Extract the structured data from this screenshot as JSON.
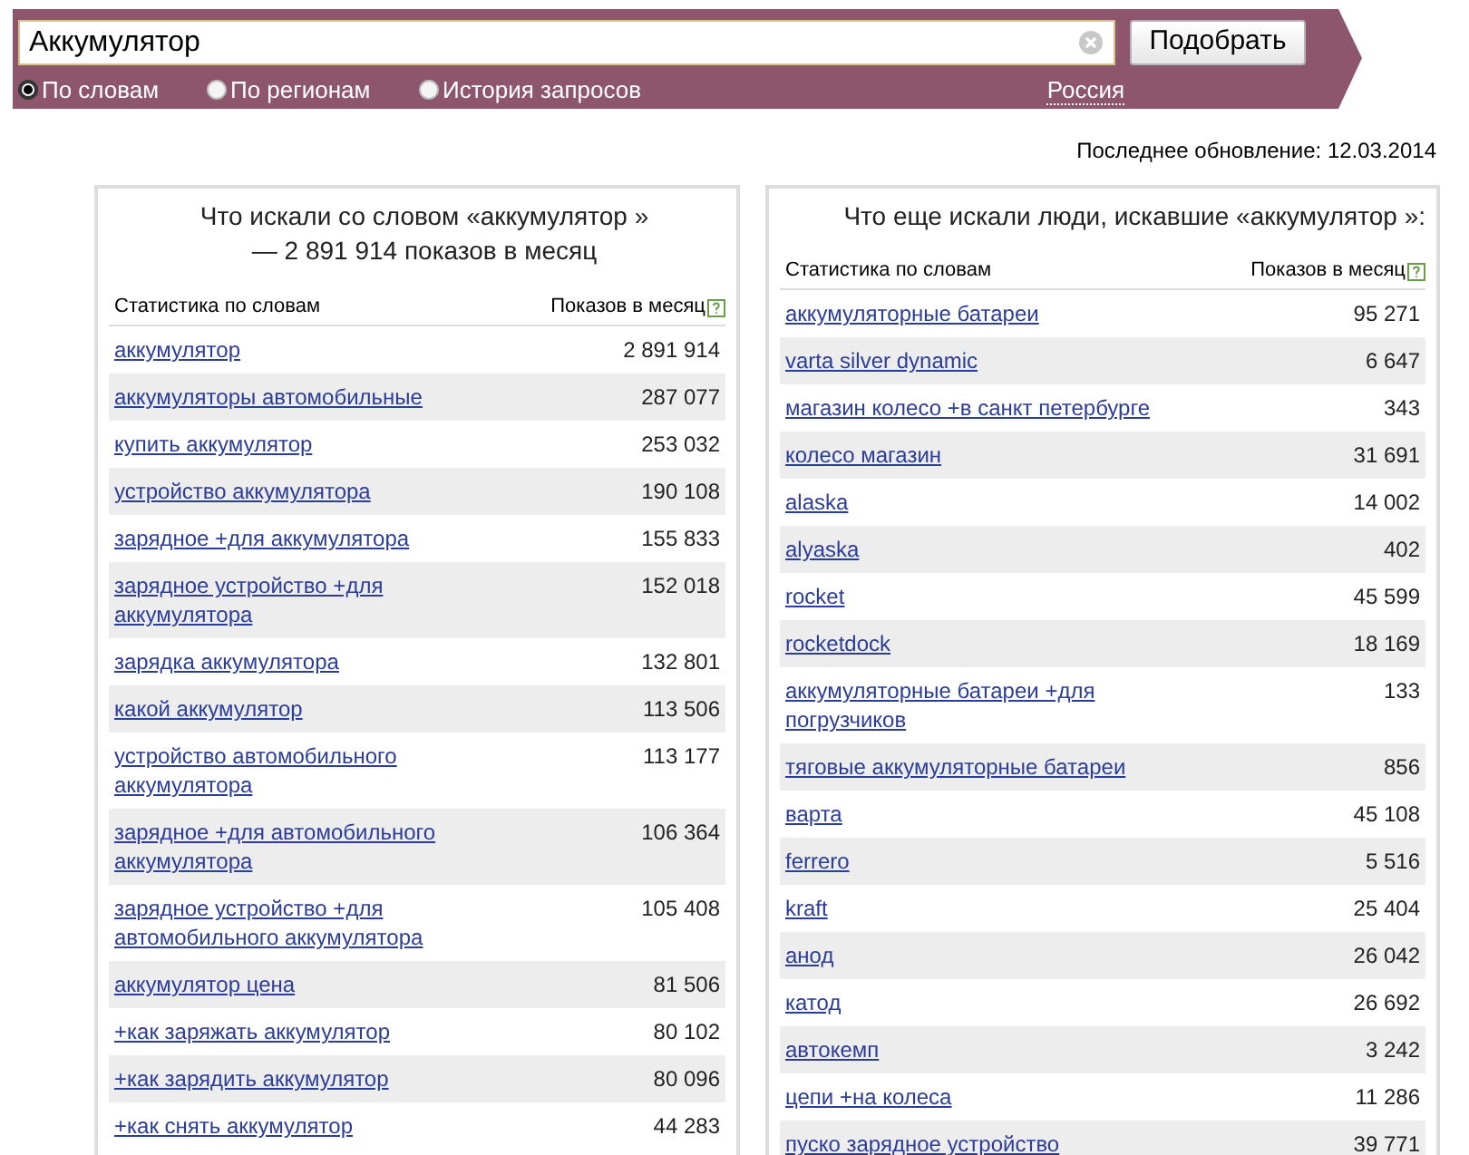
{
  "search": {
    "value": "Аккумулятор",
    "button": "Подобрать"
  },
  "modes": [
    {
      "label": "По словам",
      "selected": true
    },
    {
      "label": "По регионам",
      "selected": false
    },
    {
      "label": "История запросов",
      "selected": false
    }
  ],
  "region": "Россия",
  "last_update": "Последнее обновление: 12.03.2014",
  "panels": [
    {
      "title": "Что искали со словом «аккумулятор » — 2 891 914 показов в месяц",
      "columns": [
        "Статистика по словам",
        "Показов в месяц"
      ],
      "rows": [
        {
          "phrase": "аккумулятор",
          "count": "2 891 914"
        },
        {
          "phrase": "аккумуляторы автомобильные",
          "count": "287 077"
        },
        {
          "phrase": "купить аккумулятор",
          "count": "253 032"
        },
        {
          "phrase": "устройство аккумулятора",
          "count": "190 108"
        },
        {
          "phrase": "зарядное +для аккумулятора",
          "count": "155 833"
        },
        {
          "phrase": "зарядное устройство +для аккумулятора",
          "count": "152 018"
        },
        {
          "phrase": "зарядка аккумулятора",
          "count": "132 801"
        },
        {
          "phrase": "какой аккумулятор",
          "count": "113 506"
        },
        {
          "phrase": "устройство автомобильного аккумулятора",
          "count": "113 177"
        },
        {
          "phrase": "зарядное +для автомобильного аккумулятора",
          "count": "106 364"
        },
        {
          "phrase": "зарядное устройство +для автомобильного аккумулятора",
          "count": "105 408"
        },
        {
          "phrase": "аккумулятор цена",
          "count": "81 506"
        },
        {
          "phrase": "+как заряжать аккумулятор",
          "count": "80 102"
        },
        {
          "phrase": "+как зарядить аккумулятор",
          "count": "80 096"
        },
        {
          "phrase": "+как снять аккумулятор",
          "count": "44 283"
        }
      ]
    },
    {
      "title": "Что еще искали люди, искавшие «аккумулятор »:",
      "columns": [
        "Статистика по словам",
        "Показов в месяц"
      ],
      "rows": [
        {
          "phrase": "аккумуляторные батареи",
          "count": "95 271"
        },
        {
          "phrase": "varta silver dynamic",
          "count": "6 647"
        },
        {
          "phrase": "магазин колесо +в санкт петербурге",
          "count": "343"
        },
        {
          "phrase": "колесо магазин",
          "count": "31 691"
        },
        {
          "phrase": "alaska",
          "count": "14 002"
        },
        {
          "phrase": "alyaska",
          "count": "402"
        },
        {
          "phrase": "rocket",
          "count": "45 599"
        },
        {
          "phrase": "rocketdock",
          "count": "18 169"
        },
        {
          "phrase": "аккумуляторные батареи +для погрузчиков",
          "count": "133"
        },
        {
          "phrase": "тяговые аккумуляторные батареи",
          "count": "856"
        },
        {
          "phrase": "варта",
          "count": "45 108"
        },
        {
          "phrase": "ferrero",
          "count": "5 516"
        },
        {
          "phrase": "kraft",
          "count": "25 404"
        },
        {
          "phrase": "анод",
          "count": "26 042"
        },
        {
          "phrase": "катод",
          "count": "26 692"
        },
        {
          "phrase": "автокемп",
          "count": "3 242"
        },
        {
          "phrase": "цепи +на колеса",
          "count": "11 286"
        },
        {
          "phrase": "пуско зарядное устройство",
          "count": "39 771"
        }
      ]
    }
  ]
}
